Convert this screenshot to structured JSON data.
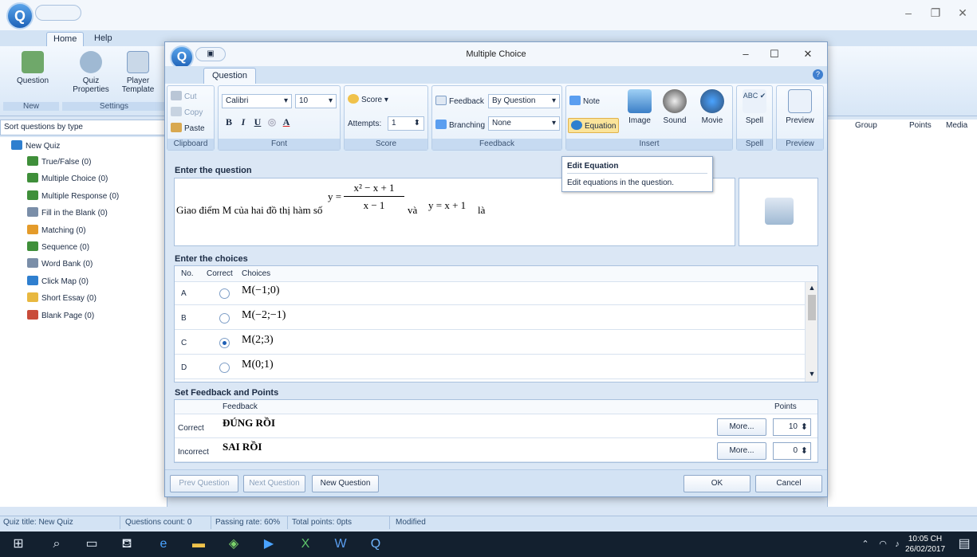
{
  "app": {
    "home_tab": "Home",
    "help_tab": "Help",
    "ribbon": {
      "question": "Question",
      "quiz_properties": "Quiz Properties",
      "player_template": "Player Template",
      "group_new": "New",
      "group_settings": "Settings"
    },
    "sort_label": "Sort questions by type",
    "tree_root": "New Quiz",
    "tree_items": [
      {
        "label": "True/False  (0)",
        "color": "#3f8f3a"
      },
      {
        "label": "Multiple Choice  (0)",
        "color": "#3f8f3a"
      },
      {
        "label": "Multiple Response  (0)",
        "color": "#3f8f3a"
      },
      {
        "label": "Fill in the Blank  (0)",
        "color": "#7a8ea8"
      },
      {
        "label": "Matching  (0)",
        "color": "#e49b2a"
      },
      {
        "label": "Sequence  (0)",
        "color": "#3f8f3a"
      },
      {
        "label": "Word Bank  (0)",
        "color": "#7a8ea8"
      },
      {
        "label": "Click Map  (0)",
        "color": "#2f7fcf"
      },
      {
        "label": "Short Essay  (0)",
        "color": "#e8b840"
      },
      {
        "label": "Blank Page  (0)",
        "color": "#c94c3a"
      }
    ],
    "grid_headers": {
      "group": "Group",
      "points": "Points",
      "media": "Media"
    },
    "status": {
      "quiz_title": "Quiz title: New Quiz",
      "questions_count": "Questions count: 0",
      "passing_rate": "Passing rate: 60%",
      "total_points": "Total points: 0pts",
      "modified": "Modified"
    }
  },
  "dialog": {
    "title": "Multiple Choice",
    "tab": "Question",
    "clipboard": {
      "cut": "Cut",
      "copy": "Copy",
      "paste": "Paste",
      "label": "Clipboard"
    },
    "font": {
      "family": "Calibri",
      "size": "10",
      "label": "Font"
    },
    "score": {
      "score": "Score",
      "attempts_label": "Attempts:",
      "attempts_value": "1",
      "label": "Score"
    },
    "feedback": {
      "feedback": "Feedback",
      "feedback_value": "By Question",
      "branching": "Branching",
      "branching_value": "None",
      "label": "Feedback"
    },
    "insert": {
      "note": "Note",
      "equation": "Equation",
      "image": "Image",
      "sound": "Sound",
      "movie": "Movie",
      "label": "Insert"
    },
    "spell": {
      "spell": "Spell",
      "label": "Spell"
    },
    "preview": {
      "preview": "Preview",
      "label": "Preview"
    },
    "tooltip": {
      "title": "Edit Equation",
      "body": "Edit equations in the question."
    },
    "enter_question": "Enter the question",
    "question": {
      "text": "Giao điểm M của hai đồ thị hàm số",
      "eq_y": "y =",
      "numerator": "x² − x + 1",
      "denominator": "x − 1",
      "conj": "và",
      "eq2": "y = x + 1",
      "end": "là"
    },
    "enter_choices": "Enter the choices",
    "choice_headers": {
      "no": "No.",
      "correct": "Correct",
      "choices": "Choices"
    },
    "choices": [
      {
        "no": "A",
        "text": "M(−1;0)",
        "correct": false
      },
      {
        "no": "B",
        "text": "M(−2;−1)",
        "correct": false
      },
      {
        "no": "C",
        "text": "M(2;3)",
        "correct": true
      },
      {
        "no": "D",
        "text": "M(0;1)",
        "correct": false
      }
    ],
    "set_feedback": "Set Feedback and Points",
    "fb_headers": {
      "feedback": "Feedback",
      "points": "Points"
    },
    "feedback_rows": [
      {
        "label": "Correct",
        "text": "ĐÚNG RỒI",
        "more": "More...",
        "points": "10"
      },
      {
        "label": "Incorrect",
        "text": "SAI RỒI",
        "more": "More...",
        "points": "0"
      }
    ],
    "buttons": {
      "prev": "Prev Question",
      "next": "Next Question",
      "new": "New Question",
      "ok": "OK",
      "cancel": "Cancel"
    }
  },
  "taskbar": {
    "time": "10:05 CH",
    "date": "26/02/2017"
  }
}
